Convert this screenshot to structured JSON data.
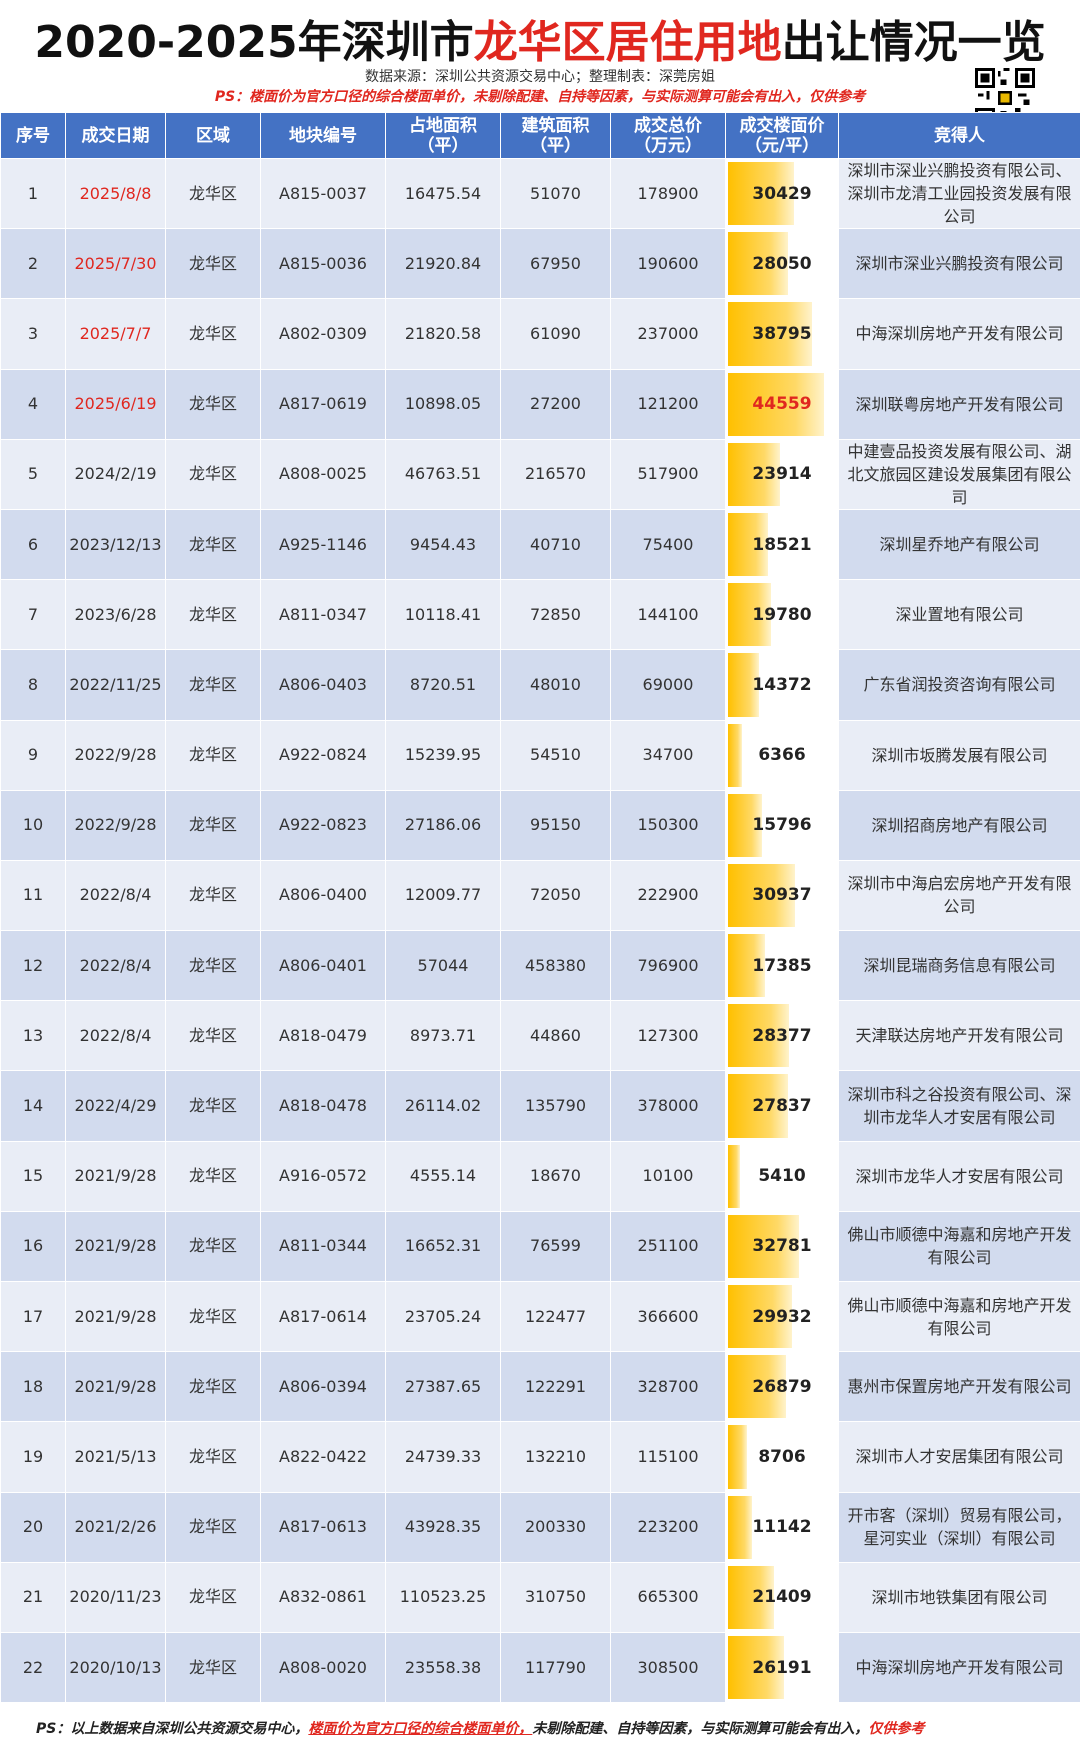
{
  "header": {
    "title_prefix": "2020-2025年深圳市",
    "title_highlight": "龙华区居住用地",
    "title_suffix": "出让情况一览",
    "source": "数据来源：深圳公共资源交易中心；整理制表：深莞房姐",
    "ps": "PS：楼面价为官方口径的综合楼面单价，未剔除配建、自持等因素，与实际测算可能会有出入，仅供参考"
  },
  "columns": [
    "序号",
    "成交日期",
    "区域",
    "地块编号",
    "占地面积\n（平）",
    "建筑面积\n（平）",
    "成交总价\n（万元）",
    "成交楼面价\n（元/平）",
    "竞得人"
  ],
  "rows": [
    {
      "no": "1",
      "date": "2025/8/8",
      "red": true,
      "district": "龙华区",
      "parcel": "A815-0037",
      "land": "16475.54",
      "gfa": "51070",
      "total": "178900",
      "price": 30429,
      "buyer": "深圳市深业兴鹏投资有限公司、深圳市龙清工业园投资发展有限公司"
    },
    {
      "no": "2",
      "date": "2025/7/30",
      "red": true,
      "district": "龙华区",
      "parcel": "A815-0036",
      "land": "21920.84",
      "gfa": "67950",
      "total": "190600",
      "price": 28050,
      "buyer": "深圳市深业兴鹏投资有限公司"
    },
    {
      "no": "3",
      "date": "2025/7/7",
      "red": true,
      "district": "龙华区",
      "parcel": "A802-0309",
      "land": "21820.58",
      "gfa": "61090",
      "total": "237000",
      "price": 38795,
      "buyer": "中海深圳房地产开发有限公司"
    },
    {
      "no": "4",
      "date": "2025/6/19",
      "red": true,
      "district": "龙华区",
      "parcel": "A817-0619",
      "land": "10898.05",
      "gfa": "27200",
      "total": "121200",
      "price": 44559,
      "max": true,
      "buyer": "深圳联粤房地产开发有限公司"
    },
    {
      "no": "5",
      "date": "2024/2/19",
      "red": false,
      "district": "龙华区",
      "parcel": "A808-0025",
      "land": "46763.51",
      "gfa": "216570",
      "total": "517900",
      "price": 23914,
      "buyer": "中建壹品投资发展有限公司、湖北文旅园区建设发展集团有限公司"
    },
    {
      "no": "6",
      "date": "2023/12/13",
      "red": false,
      "district": "龙华区",
      "parcel": "A925-1146",
      "land": "9454.43",
      "gfa": "40710",
      "total": "75400",
      "price": 18521,
      "buyer": "深圳星乔地产有限公司"
    },
    {
      "no": "7",
      "date": "2023/6/28",
      "red": false,
      "district": "龙华区",
      "parcel": "A811-0347",
      "land": "10118.41",
      "gfa": "72850",
      "total": "144100",
      "price": 19780,
      "buyer": "深业置地有限公司"
    },
    {
      "no": "8",
      "date": "2022/11/25",
      "red": false,
      "district": "龙华区",
      "parcel": "A806-0403",
      "land": "8720.51",
      "gfa": "48010",
      "total": "69000",
      "price": 14372,
      "buyer": "广东省润投资咨询有限公司"
    },
    {
      "no": "9",
      "date": "2022/9/28",
      "red": false,
      "district": "龙华区",
      "parcel": "A922-0824",
      "land": "15239.95",
      "gfa": "54510",
      "total": "34700",
      "price": 6366,
      "buyer": "深圳市坂腾发展有限公司"
    },
    {
      "no": "10",
      "date": "2022/9/28",
      "red": false,
      "district": "龙华区",
      "parcel": "A922-0823",
      "land": "27186.06",
      "gfa": "95150",
      "total": "150300",
      "price": 15796,
      "buyer": "深圳招商房地产有限公司"
    },
    {
      "no": "11",
      "date": "2022/8/4",
      "red": false,
      "district": "龙华区",
      "parcel": "A806-0400",
      "land": "12009.77",
      "gfa": "72050",
      "total": "222900",
      "price": 30937,
      "buyer": "深圳市中海启宏房地产开发有限公司"
    },
    {
      "no": "12",
      "date": "2022/8/4",
      "red": false,
      "district": "龙华区",
      "parcel": "A806-0401",
      "land": "57044",
      "gfa": "458380",
      "total": "796900",
      "price": 17385,
      "buyer": "深圳昆瑞商务信息有限公司"
    },
    {
      "no": "13",
      "date": "2022/8/4",
      "red": false,
      "district": "龙华区",
      "parcel": "A818-0479",
      "land": "8973.71",
      "gfa": "44860",
      "total": "127300",
      "price": 28377,
      "buyer": "天津联达房地产开发有限公司"
    },
    {
      "no": "14",
      "date": "2022/4/29",
      "red": false,
      "district": "龙华区",
      "parcel": "A818-0478",
      "land": "26114.02",
      "gfa": "135790",
      "total": "378000",
      "price": 27837,
      "buyer": "深圳市科之谷投资有限公司、深圳市龙华人才安居有限公司"
    },
    {
      "no": "15",
      "date": "2021/9/28",
      "red": false,
      "district": "龙华区",
      "parcel": "A916-0572",
      "land": "4555.14",
      "gfa": "18670",
      "total": "10100",
      "price": 5410,
      "buyer": "深圳市龙华人才安居有限公司"
    },
    {
      "no": "16",
      "date": "2021/9/28",
      "red": false,
      "district": "龙华区",
      "parcel": "A811-0344",
      "land": "16652.31",
      "gfa": "76599",
      "total": "251100",
      "price": 32781,
      "buyer": "佛山市顺德中海嘉和房地产开发有限公司"
    },
    {
      "no": "17",
      "date": "2021/9/28",
      "red": false,
      "district": "龙华区",
      "parcel": "A817-0614",
      "land": "23705.24",
      "gfa": "122477",
      "total": "366600",
      "price": 29932,
      "buyer": "佛山市顺德中海嘉和房地产开发有限公司"
    },
    {
      "no": "18",
      "date": "2021/9/28",
      "red": false,
      "district": "龙华区",
      "parcel": "A806-0394",
      "land": "27387.65",
      "gfa": "122291",
      "total": "328700",
      "price": 26879,
      "buyer": "惠州市保置房地产开发有限公司"
    },
    {
      "no": "19",
      "date": "2021/5/13",
      "red": false,
      "district": "龙华区",
      "parcel": "A822-0422",
      "land": "24739.33",
      "gfa": "132210",
      "total": "115100",
      "price": 8706,
      "buyer": "深圳市人才安居集团有限公司"
    },
    {
      "no": "20",
      "date": "2021/2/26",
      "red": false,
      "district": "龙华区",
      "parcel": "A817-0613",
      "land": "43928.35",
      "gfa": "200330",
      "total": "223200",
      "price": 11142,
      "buyer": "开市客（深圳）贸易有限公司，星河实业（深圳）有限公司"
    },
    {
      "no": "21",
      "date": "2020/11/23",
      "red": false,
      "district": "龙华区",
      "parcel": "A832-0861",
      "land": "110523.25",
      "gfa": "310750",
      "total": "665300",
      "price": 21409,
      "buyer": "深圳市地铁集团有限公司"
    },
    {
      "no": "22",
      "date": "2020/10/13",
      "red": false,
      "district": "龙华区",
      "parcel": "A808-0020",
      "land": "23558.38",
      "gfa": "117790",
      "total": "308500",
      "price": 26191,
      "buyer": "中海深圳房地产开发有限公司"
    }
  ],
  "price_max": 44559,
  "footer": {
    "prefix": "PS：以上数据来自深圳公共资源交易中心，",
    "underline": "楼面价为官方口径的综合楼面单价，",
    "middle": "未剔除配建、自持等因素，与实际测算可能会有出入，",
    "suffix": "仅供参考"
  },
  "colors": {
    "header_bg": "#4472c4",
    "highlight": "#e0271f",
    "bar": "#ffc000"
  }
}
